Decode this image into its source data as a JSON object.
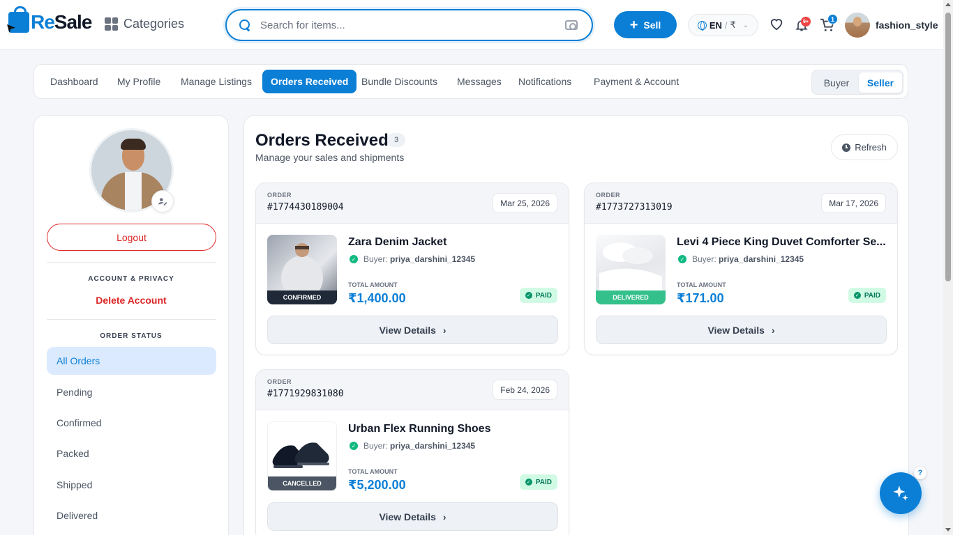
{
  "header": {
    "logo_re": "Re",
    "logo_sale": "Sale",
    "categories_label": "Categories",
    "search_placeholder": "Search for items...",
    "sell_label": "Sell",
    "language": "EN",
    "currency": "₹",
    "notifications_badge": "9+",
    "cart_badge": "1",
    "username": "fashion_style"
  },
  "nav": {
    "tabs": [
      {
        "label": "Dashboard"
      },
      {
        "label": "My Profile"
      },
      {
        "label": "Manage Listings"
      },
      {
        "label": "Orders Received",
        "active": true
      },
      {
        "label": "Bundle Discounts"
      },
      {
        "label": "Messages"
      },
      {
        "label": "Notifications"
      },
      {
        "label": "Payment & Account"
      }
    ],
    "role_buyer": "Buyer",
    "role_seller": "Seller",
    "active_role": "Seller"
  },
  "sidebar": {
    "logout_label": "Logout",
    "account_privacy_heading": "ACCOUNT & PRIVACY",
    "delete_account_label": "Delete Account",
    "order_status_heading": "ORDER STATUS",
    "statuses": [
      "All Orders",
      "Pending",
      "Confirmed",
      "Packed",
      "Shipped",
      "Delivered"
    ],
    "active_status": "All Orders"
  },
  "main": {
    "title": "Orders Received",
    "count": "3",
    "subtitle": "Manage your sales and shipments",
    "refresh_label": "Refresh",
    "order_label": "ORDER",
    "buyer_prefix": "Buyer:",
    "total_label": "TOTAL AMOUNT",
    "view_details_label": "View Details",
    "orders": [
      {
        "id": "#1774430189004",
        "date": "Mar 25, 2026",
        "item": "Zara Denim Jacket",
        "buyer": "priya_darshini_12345",
        "total": "₹1,400.00",
        "payment": "PAID",
        "status": "CONFIRMED",
        "status_color": "#1f2937"
      },
      {
        "id": "#1773727313019",
        "date": "Mar 17, 2026",
        "item": "Levi 4 Piece King Duvet Comforter Se...",
        "buyer": "priya_darshini_12345",
        "total": "₹171.00",
        "payment": "PAID",
        "status": "DELIVERED",
        "status_color": "#34c08a"
      },
      {
        "id": "#1771929831080",
        "date": "Feb 24, 2026",
        "item": "Urban Flex Running Shoes",
        "buyer": "priya_darshini_12345",
        "total": "₹5,200.00",
        "payment": "PAID",
        "status": "CANCELLED",
        "status_color": "#4b5563"
      }
    ]
  },
  "colors": {
    "accent": "#0b7fd6",
    "danger": "#dc2626",
    "paid_bg": "#d1fae5",
    "paid_text": "#047857"
  },
  "fab": {
    "help_label": "?"
  }
}
